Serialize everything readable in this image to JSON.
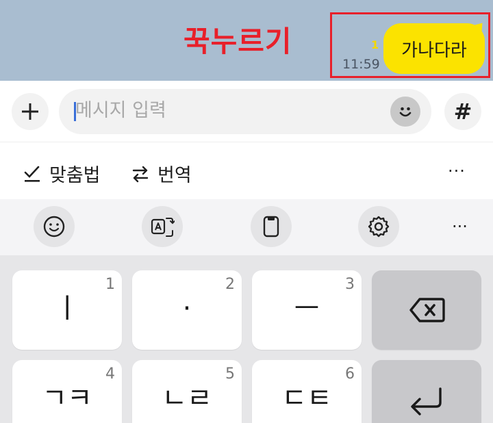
{
  "chat": {
    "overlay_label": "꾹누르기",
    "unread_count": "1",
    "time": "11:59",
    "message": "가나다라",
    "colors": {
      "bubble": "#fbe300",
      "annotation": "#e8202a"
    }
  },
  "input": {
    "placeholder": "메시지 입력",
    "plus_icon": "plus-icon",
    "hash_symbol": "#",
    "emoji_icon": "emoji-face-icon"
  },
  "suggestions": {
    "spell_label": "맞춤법",
    "translate_label": "번역",
    "more": "···"
  },
  "toolbar": {
    "icons": [
      "smiley-icon",
      "translate-icon",
      "clipboard-icon",
      "settings-icon"
    ],
    "more": "···"
  },
  "keys": [
    {
      "num": "1",
      "main": "ㅣ"
    },
    {
      "num": "2",
      "main": "·"
    },
    {
      "num": "3",
      "main": "ㅡ"
    },
    {
      "num": "4",
      "main": "ㄱㅋ"
    },
    {
      "num": "5",
      "main": "ㄴㄹ"
    },
    {
      "num": "6",
      "main": "ㄷㅌ"
    }
  ]
}
